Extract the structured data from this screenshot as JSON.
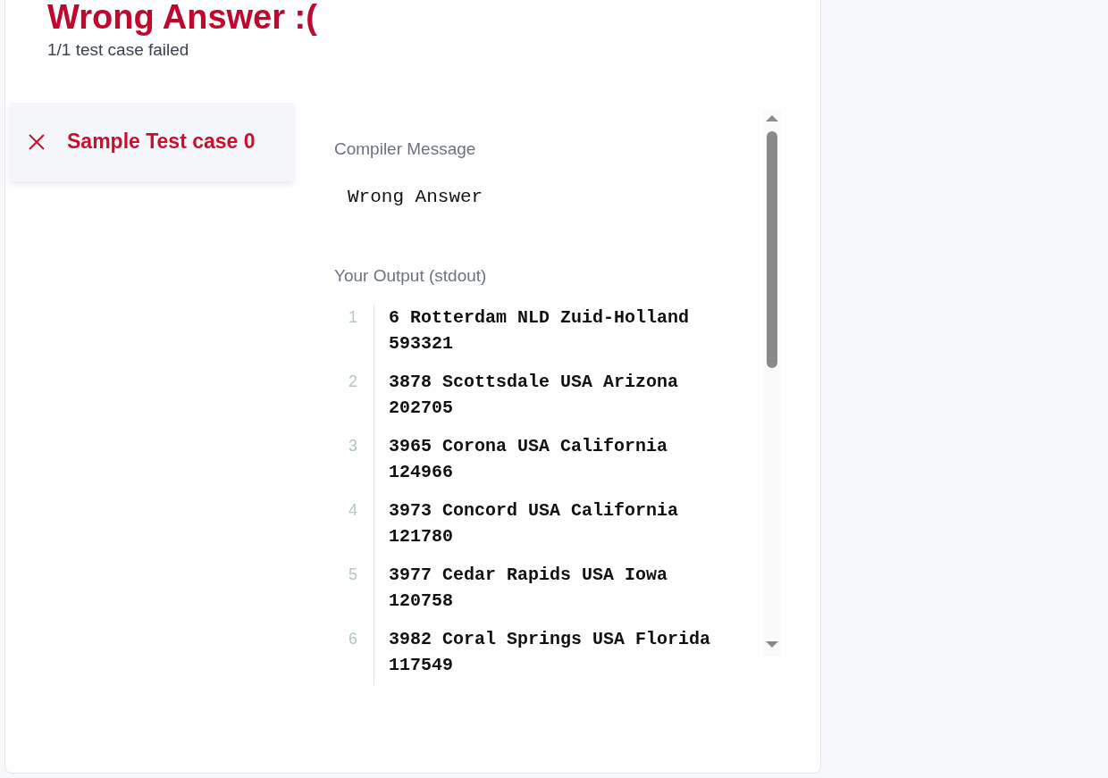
{
  "title": "Wrong Answer :(",
  "subtitle": "1/1 test case failed",
  "test_cases": [
    {
      "label": "Sample Test case 0",
      "kind": "failed",
      "selected": true
    }
  ],
  "compiler_message": {
    "label": "Compiler Message",
    "text": "Wrong Answer"
  },
  "output": {
    "label": "Your Output (stdout)",
    "lines": [
      {
        "number": "1",
        "text": "6 Rotterdam NLD Zuid-Holland 593321"
      },
      {
        "number": "2",
        "text": "3878 Scottsdale USA Arizona 202705"
      },
      {
        "number": "3",
        "text": "3965 Corona USA California 124966"
      },
      {
        "number": "4",
        "text": "3973 Concord USA California 121780"
      },
      {
        "number": "5",
        "text": "3977 Cedar Rapids USA Iowa 120758"
      },
      {
        "number": "6",
        "text": "3982 Coral Springs USA Florida 117549"
      }
    ]
  }
}
